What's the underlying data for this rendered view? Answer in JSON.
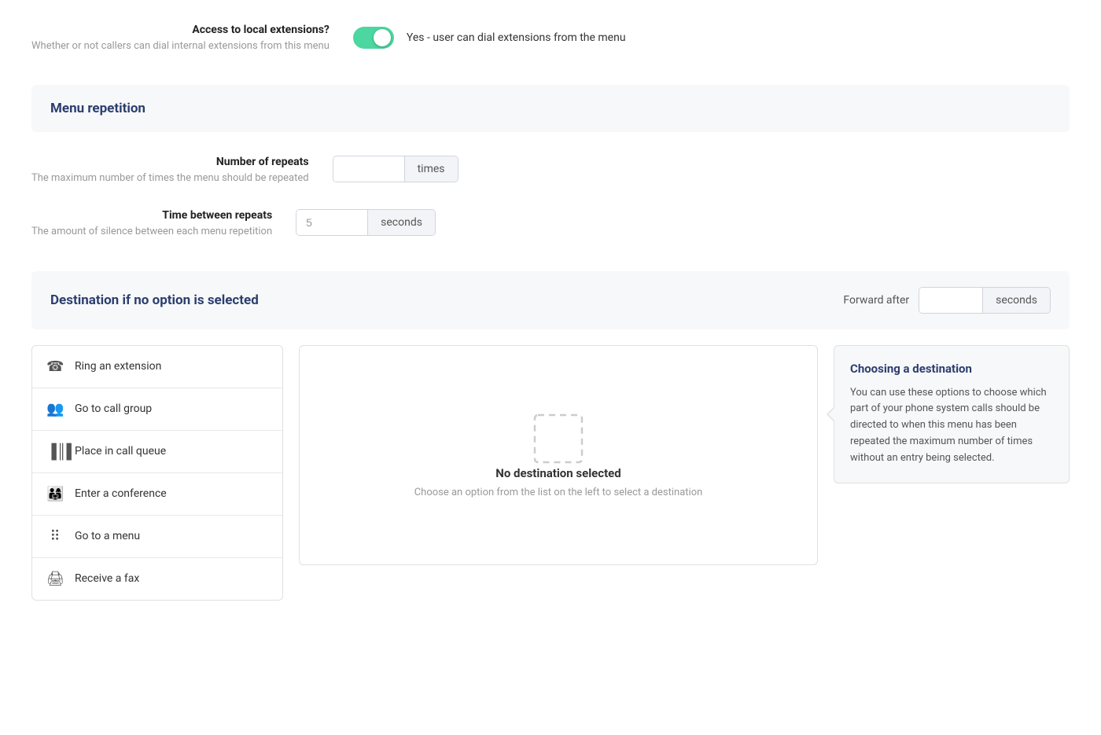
{
  "access": {
    "label": "Access to local extensions?",
    "description": "Whether or not callers can dial internal extensions from this menu",
    "toggle_state": true,
    "toggle_label": "Yes - user can dial extensions from the menu"
  },
  "menu_repetition": {
    "section_title": "Menu repetition",
    "number_of_repeats": {
      "label": "Number of repeats",
      "description": "The maximum number of times the menu should be repeated",
      "value": "",
      "suffix": "times"
    },
    "time_between_repeats": {
      "label": "Time between repeats",
      "description": "The amount of silence between each menu repetition",
      "value": "5",
      "suffix": "seconds"
    }
  },
  "destination": {
    "section_title": "Destination if no option is selected",
    "forward_after_label": "Forward after",
    "forward_after_value": "",
    "forward_after_suffix": "seconds"
  },
  "options_list": {
    "items": [
      {
        "id": "ring-extension",
        "label": "Ring an extension",
        "icon": "📞"
      },
      {
        "id": "call-group",
        "label": "Go to call group",
        "icon": "👥"
      },
      {
        "id": "call-queue",
        "label": "Place in call queue",
        "icon": "📊"
      },
      {
        "id": "conference",
        "label": "Enter a conference",
        "icon": "👨‍👩‍👧"
      },
      {
        "id": "menu",
        "label": "Go to a menu",
        "icon": "⠿"
      },
      {
        "id": "fax",
        "label": "Receive a fax",
        "icon": "🖨"
      }
    ]
  },
  "empty_state": {
    "title": "No destination selected",
    "subtitle": "Choose an option from the list on the left to select a destination"
  },
  "info_box": {
    "title": "Choosing a destination",
    "text": "You can use these options to choose which part of your phone system calls should be directed to when this menu has been repeated the maximum number of times without an entry being selected."
  }
}
